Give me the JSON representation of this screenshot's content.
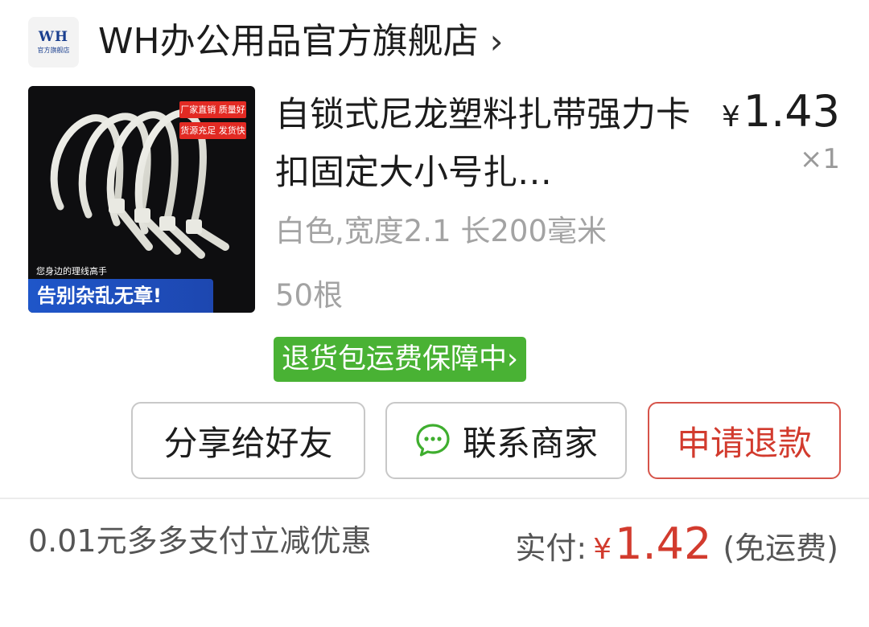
{
  "store": {
    "logo_text": "WH",
    "logo_subtext": "官方旗舰店",
    "name": "WH办公用品官方旗舰店",
    "arrow": "›"
  },
  "product": {
    "image": {
      "badges": [
        "厂家直销 质量好",
        "货源充足 发货快"
      ],
      "tagline": "您身边的理线高手",
      "banner": "告别杂乱无章!"
    },
    "title": "自锁式尼龙塑料扎带强力卡扣固定大小号扎…",
    "price_symbol": "¥",
    "price": "1.43",
    "quantity": "×1",
    "spec_line1": "白色,宽度2.1 长200毫米",
    "spec_line2": "50根",
    "return_badge": "退货包运费保障中›"
  },
  "actions": {
    "share_label": "分享给好友",
    "contact_label": "联系商家",
    "refund_label": "申请退款"
  },
  "summary": {
    "discount_text": "0.01元多多支付立减优惠",
    "paid_label": "实付:",
    "paid_symbol": "¥",
    "paid_amount": "1.42",
    "shipping_note": "(免运费)"
  },
  "colors": {
    "accent_red": "#d23b2e",
    "badge_green": "#49b234",
    "banner_blue": "#1f56c9"
  },
  "icons": {
    "store_arrow": "chevron-right-icon",
    "contact": "chat-bubble-icon"
  }
}
